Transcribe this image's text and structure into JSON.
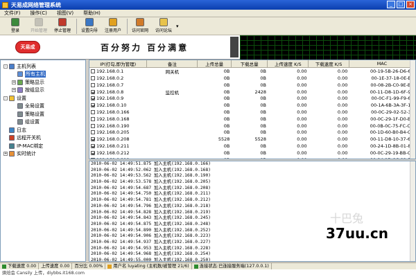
{
  "window": {
    "title": "天易成网络管理系统"
  },
  "menu": [
    "文件(F)",
    "操作(C)",
    "视图(V)",
    "帮助(H)"
  ],
  "toolbar": [
    {
      "label": "登录",
      "icon": "login-icon",
      "color": "#3c8a3c",
      "enabled": true
    },
    {
      "label": "开始管理",
      "icon": "play-icon",
      "color": "#888888",
      "enabled": false
    },
    {
      "label": "停止管理",
      "icon": "stop-icon",
      "color": "#c0392b",
      "enabled": true
    },
    {
      "label": "设置向导",
      "icon": "wizard-icon",
      "color": "#3b77c4",
      "enabled": true
    },
    {
      "label": "注册用户",
      "icon": "register-icon",
      "color": "#e0a020",
      "enabled": true
    },
    {
      "label": "访问官网",
      "icon": "home-icon",
      "color": "#d07a2a",
      "enabled": true
    },
    {
      "label": "访问论坛",
      "icon": "forum-icon",
      "color": "#e8c34a",
      "enabled": true
    }
  ],
  "banner": {
    "logo": "天易成",
    "slogan": "百分努力 百分满意"
  },
  "tree": [
    {
      "label": "主机列表",
      "level": 0,
      "icon": "computers-icon",
      "expander": "-",
      "selected": false
    },
    {
      "label": "所有主机",
      "level": 1,
      "icon": "computer-icon",
      "expander": "",
      "selected": true
    },
    {
      "label": "策略显示",
      "level": 1,
      "icon": "policy-icon",
      "expander": "+",
      "selected": false
    },
    {
      "label": "按组显示",
      "level": 1,
      "icon": "group-icon",
      "expander": "+",
      "selected": false
    },
    {
      "label": "设置",
      "level": 0,
      "icon": "folder-icon",
      "expander": "-",
      "selected": false
    },
    {
      "label": "全局设置",
      "level": 1,
      "icon": "gear-icon",
      "expander": "",
      "selected": false
    },
    {
      "label": "策略设置",
      "level": 1,
      "icon": "gear-icon",
      "expander": "",
      "selected": false
    },
    {
      "label": "组设置",
      "level": 1,
      "icon": "gear-icon",
      "expander": "",
      "selected": false
    },
    {
      "label": "日志",
      "level": 0,
      "icon": "log-icon",
      "expander": "",
      "selected": false
    },
    {
      "label": "远程开关机",
      "level": 0,
      "icon": "power-icon",
      "expander": "",
      "selected": false
    },
    {
      "label": "IP-MAC绑定",
      "level": 0,
      "icon": "bind-icon",
      "expander": "",
      "selected": false
    },
    {
      "label": "实时统计",
      "level": 0,
      "icon": "stats-icon",
      "expander": "+",
      "selected": false
    }
  ],
  "table": {
    "columns": [
      "IP(打勾,即为管理)",
      "备注",
      "上传总量",
      "下载总量",
      "上传速度 K/S",
      "下载速度 K/S",
      "MAC"
    ],
    "rows": [
      {
        "checked": false,
        "ip": "192.168.0.1",
        "note": "网关机",
        "up": "0B",
        "down": "0B",
        "ups": "0.00",
        "downs": "0.00",
        "mac": "00-19-5B-26-D6-62"
      },
      {
        "checked": false,
        "ip": "192.168.0.2",
        "note": "",
        "up": "0B",
        "down": "0B",
        "ups": "0.00",
        "downs": "0.00",
        "mac": "00-1E-37-18-0E-BF"
      },
      {
        "checked": false,
        "ip": "192.168.0.7",
        "note": "",
        "up": "0B",
        "down": "0B",
        "ups": "0.00",
        "downs": "0.00",
        "mac": "00-08-2B-C0-9E-B9"
      },
      {
        "checked": true,
        "ip": "192.168.0.8",
        "note": "监控机",
        "up": "0B",
        "down": "2428",
        "ups": "0.00",
        "downs": "0.00",
        "mac": "00-11-D8-1D-6F-97"
      },
      {
        "checked": true,
        "ip": "192.168.0.9",
        "note": "",
        "up": "0B",
        "down": "0B",
        "ups": "0.00",
        "downs": "0.00",
        "mac": "00-0C-F1-99-F9-69"
      },
      {
        "checked": true,
        "ip": "192.168.0.10",
        "note": "",
        "up": "0B",
        "down": "0B",
        "ups": "0.00",
        "downs": "0.00",
        "mac": "00-1A-6B-3A-3F-15"
      },
      {
        "checked": false,
        "ip": "192.168.0.166",
        "note": "",
        "up": "0B",
        "down": "0B",
        "ups": "0.00",
        "downs": "0.00",
        "mac": "00-0C-29-02-52-3F"
      },
      {
        "checked": false,
        "ip": "192.168.0.168",
        "note": "",
        "up": "0B",
        "down": "0B",
        "ups": "0.00",
        "downs": "0.00",
        "mac": "00-0C-29-1F-D0-B8"
      },
      {
        "checked": false,
        "ip": "192.168.0.190",
        "note": "",
        "up": "0B",
        "down": "0B",
        "ups": "0.00",
        "downs": "0.00",
        "mac": "00-0B-0C-75-FC-CC"
      },
      {
        "checked": false,
        "ip": "192.168.0.205",
        "note": "",
        "up": "0B",
        "down": "0B",
        "ups": "0.00",
        "downs": "0.00",
        "mac": "00-1D-60-B0-B4-C5"
      },
      {
        "checked": true,
        "ip": "192.168.0.208",
        "note": "",
        "up": "5528",
        "down": "5528",
        "ups": "0.00",
        "downs": "0.00",
        "mac": "00-11-D8-10-37-6B"
      },
      {
        "checked": true,
        "ip": "192.168.0.211",
        "note": "",
        "up": "0B",
        "down": "0B",
        "ups": "0.00",
        "downs": "0.00",
        "mac": "00-24-1D-8B-01-85"
      },
      {
        "checked": true,
        "ip": "192.168.0.212",
        "note": "",
        "up": "0B",
        "down": "0B",
        "ups": "0.00",
        "downs": "0.00",
        "mac": "00-0C-29-19-BB-C8"
      },
      {
        "checked": false,
        "ip": "192.168.0.218",
        "note": "",
        "up": "0B",
        "down": "0B",
        "ups": "0.00",
        "downs": "0.00",
        "mac": "00-24-1D-8C-92-53"
      }
    ]
  },
  "log": [
    "2010-06-02 14:49:51.875 加入主机(192.168.0.166)",
    "2010-06-02 14:49:52.062 加入主机(192.168.0.168)",
    "2010-06-02 14:49:53.562 加入主机(192.168.0.190)",
    "2010-06-02 14:49:53.578 加入主机(192.168.0.205)",
    "2010-06-02 14:49:54.687 加入主机(192.168.0.208)",
    "2010-06-02 14:49:54.750 加入主机(192.168.0.211)",
    "2010-06-02 14:49:54.781 加入主机(192.168.0.212)",
    "2010-06-02 14:49:54.796 加入主机(192.168.0.218)",
    "2010-06-02 14:49:54.828 加入主机(192.168.0.219)",
    "2010-06-02 14:49:54.843 加入主机(192.168.0.245)",
    "2010-06-02 14:49:54.875 加入主机(192.168.0.248)",
    "2010-06-02 14:49:54.890 加入主机(192.168.0.252)",
    "2010-06-02 14:49:54.906 加入主机(192.168.0.223)",
    "2010-06-02 14:49:54.937 加入主机(192.168.0.227)",
    "2010-06-02 14:49:54.953 加入主机(192.168.0.228)",
    "2010-06-02 14:49:54.968 加入主机(192.168.0.254)",
    "2010-06-02 14:49:55.000 加入主机(192.168.0.250)",
    "2010-06-02 14:49:55.093 加入主机(192.168.0.7)"
  ],
  "status": {
    "down_speed": "下载速度 0.00",
    "up_speed": "上传速度 0.00",
    "percent": "百分比 0.00%",
    "user": "用户名 luyating",
    "hosts": "(主机数/被管理 21/6)",
    "conn": "连接状态:已连接服务端(127.0.0.1)"
  },
  "footer": {
    "text": "烘焙会 Cansily 上传，diybbs.it168.com"
  },
  "watermark": {
    "text": "37uu.cn",
    "faint": "十巴兔"
  }
}
